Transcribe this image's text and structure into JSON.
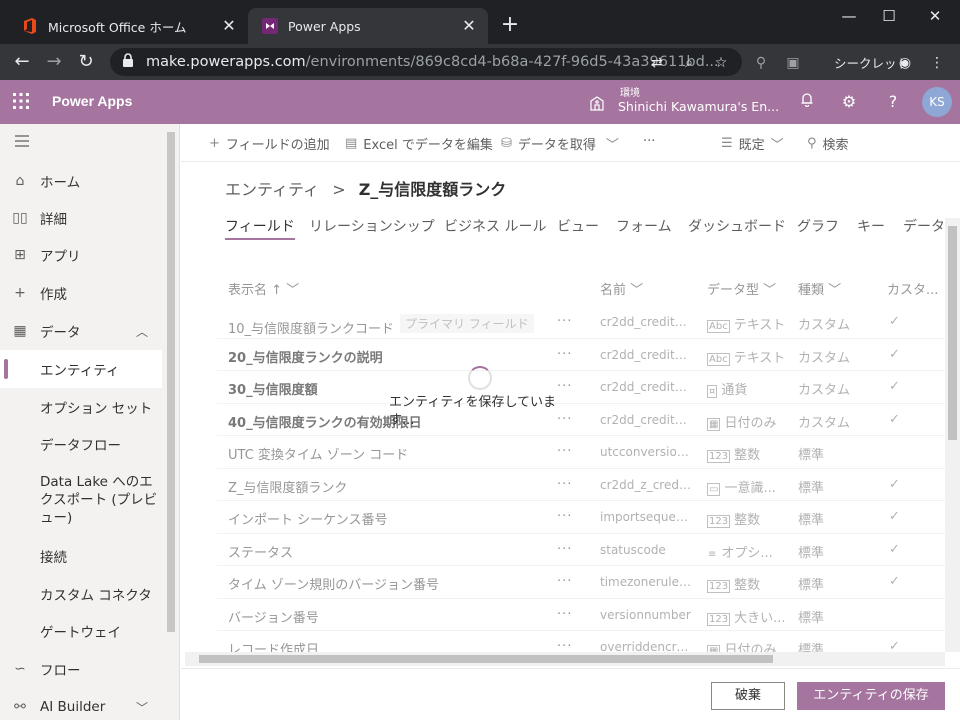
{
  "browser": {
    "tabs": [
      {
        "title": "Microsoft Office ホーム",
        "close": "✕"
      },
      {
        "title": "Power Apps",
        "close": "✕"
      }
    ],
    "new_tab": "+",
    "window_controls": {
      "minimize": "—",
      "maximize": "☐",
      "close": "✕"
    },
    "url_host": "make.powerapps.com",
    "url_path": "/environments/869c8cd4-b68a-427f-96d5-43a39611bd...",
    "incognito_label": "シークレット"
  },
  "header": {
    "app_name": "Power Apps",
    "environment_label": "環境",
    "environment_name": "Shinichi Kawamura's En...",
    "avatar_initials": "KS"
  },
  "leftnav": {
    "items": [
      {
        "label": "ホーム",
        "icon": "home-icon"
      },
      {
        "label": "詳細",
        "icon": "book-icon"
      },
      {
        "label": "アプリ",
        "icon": "apps-icon"
      },
      {
        "label": "作成",
        "icon": "plus-icon"
      },
      {
        "label": "データ",
        "icon": "table-icon"
      },
      {
        "label": "エンティティ"
      },
      {
        "label": "オプション セット"
      },
      {
        "label": "データフロー"
      },
      {
        "label": "Data Lake へのエクスポート (プレビュー)"
      },
      {
        "label": "接続"
      },
      {
        "label": "カスタム コネクタ"
      },
      {
        "label": "ゲートウェイ"
      },
      {
        "label": "フロー",
        "icon": "flow-icon"
      },
      {
        "label": "AI Builder",
        "icon": "ai-icon"
      }
    ]
  },
  "commandbar": {
    "add_field": "フィールドの追加",
    "edit_excel": "Excel でデータを編集",
    "get_data": "データを取得",
    "more": "···",
    "view_default": "既定",
    "search": "検索"
  },
  "breadcrumb": {
    "parent": "エンティティ",
    "separator": ">",
    "current": "Z_与信限度額ランク"
  },
  "tabs": [
    "フィールド",
    "リレーションシップ",
    "ビジネス ルール",
    "ビュー",
    "フォーム",
    "ダッシュボード",
    "グラフ",
    "キー",
    "データ"
  ],
  "grid": {
    "headers": {
      "display_name": "表示名 ↑",
      "name": "名前",
      "data_type": "データ型",
      "kind": "種類",
      "custom": "カスタ..."
    },
    "primary_badge": "プライマリ フィールド",
    "rows": [
      {
        "display": "10_与信限度額ランクコード",
        "dots": "···",
        "name": "cr2dd_credit_li...",
        "type": "テキスト",
        "type_icon": "Abc",
        "kind": "カスタム",
        "check": "✓"
      },
      {
        "display": "20_与信限度ランクの説明",
        "dots": "···",
        "name": "cr2dd_credit_li...",
        "type": "テキスト",
        "type_icon": "Abc",
        "kind": "カスタム",
        "check": "✓"
      },
      {
        "display": "30_与信限度額",
        "dots": "···",
        "name": "cr2dd_credit_li...",
        "type": "通貨",
        "type_icon": "¤",
        "kind": "カスタム",
        "check": "✓"
      },
      {
        "display": "40_与信限度ランクの有効期限日",
        "dots": "···",
        "name": "cr2dd_credit_li...",
        "type": "日付のみ",
        "type_icon": "▦",
        "kind": "カスタム",
        "check": "✓"
      },
      {
        "display": "UTC 変換タイム ゾーン コード",
        "dots": "···",
        "name": "utcconversion...",
        "type": "整数",
        "type_icon": "123",
        "kind": "標準",
        "check": ""
      },
      {
        "display": "Z_与信限度額ランク",
        "dots": "···",
        "name": "cr2dd_z_credit...",
        "type": "一意識...",
        "type_icon": "▭",
        "kind": "標準",
        "check": "✓"
      },
      {
        "display": "インポート シーケンス番号",
        "dots": "···",
        "name": "importsequen...",
        "type": "整数",
        "type_icon": "123",
        "kind": "標準",
        "check": "✓"
      },
      {
        "display": "ステータス",
        "dots": "···",
        "name": "statuscode",
        "type": "オプシ...",
        "type_icon": "≡",
        "kind": "標準",
        "check": "✓"
      },
      {
        "display": "タイム ゾーン規則のバージョン番号",
        "dots": "···",
        "name": "timezonerulev...",
        "type": "整数",
        "type_icon": "123",
        "kind": "標準",
        "check": "✓"
      },
      {
        "display": "バージョン番号",
        "dots": "···",
        "name": "versionnumber",
        "type": "大きい...",
        "type_icon": "123",
        "kind": "標準",
        "check": ""
      },
      {
        "display": "レコード作成日",
        "dots": "···",
        "name": "overriddencre...",
        "type": "日付のみ",
        "type_icon": "▦",
        "kind": "標準",
        "check": "✓"
      }
    ]
  },
  "saving": {
    "message": "エンティティを保存していま す..."
  },
  "footer": {
    "discard": "破棄",
    "save": "エンティティの保存"
  },
  "colors": {
    "brand": "#a5759f",
    "chrome_dark": "#202124"
  }
}
